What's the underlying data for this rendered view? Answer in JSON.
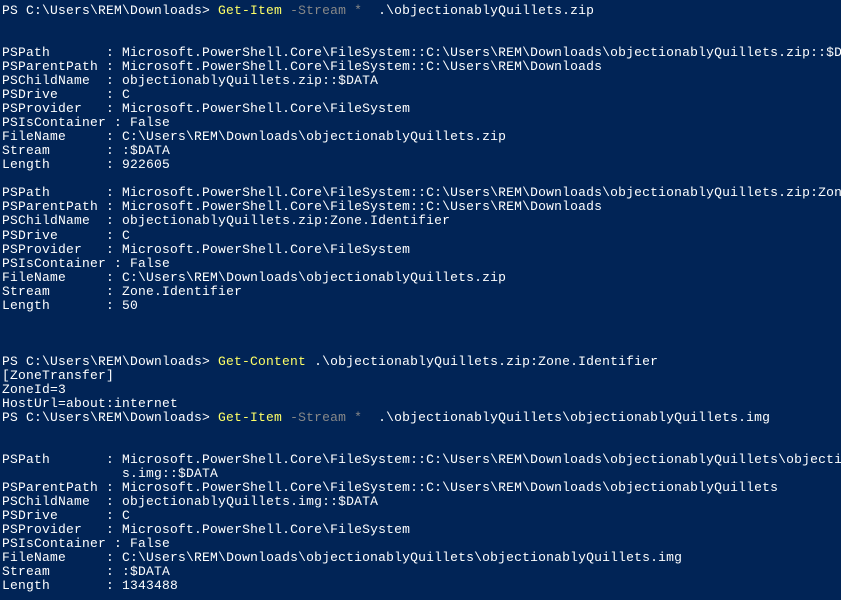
{
  "cmd1": {
    "prompt": "PS C:\\Users\\REM\\Downloads> ",
    "cmdlet": "Get-Item",
    "param": " -Stream *",
    "argument": "  .\\objectionablyQuillets.zip"
  },
  "out1": [
    {
      "label": "PSPath       ",
      "sep": ": ",
      "val": "Microsoft.PowerShell.Core\\FileSystem::C:\\Users\\REM\\Downloads\\objectionablyQuillets.zip::$DATA"
    },
    {
      "label": "PSParentPath ",
      "sep": ": ",
      "val": "Microsoft.PowerShell.Core\\FileSystem::C:\\Users\\REM\\Downloads"
    },
    {
      "label": "PSChildName  ",
      "sep": ": ",
      "val": "objectionablyQuillets.zip::$DATA"
    },
    {
      "label": "PSDrive      ",
      "sep": ": ",
      "val": "C"
    },
    {
      "label": "PSProvider   ",
      "sep": ": ",
      "val": "Microsoft.PowerShell.Core\\FileSystem"
    },
    {
      "label": "PSIsContainer",
      "sep": " : ",
      "val": "False"
    },
    {
      "label": "FileName     ",
      "sep": ": ",
      "val": "C:\\Users\\REM\\Downloads\\objectionablyQuillets.zip"
    },
    {
      "label": "Stream       ",
      "sep": ": ",
      "val": ":$DATA"
    },
    {
      "label": "Length       ",
      "sep": ": ",
      "val": "922605"
    }
  ],
  "out2": [
    {
      "label": "PSPath       ",
      "sep": ": ",
      "val": "Microsoft.PowerShell.Core\\FileSystem::C:\\Users\\REM\\Downloads\\objectionablyQuillets.zip:Zone.Identifier"
    },
    {
      "label": "PSParentPath ",
      "sep": ": ",
      "val": "Microsoft.PowerShell.Core\\FileSystem::C:\\Users\\REM\\Downloads"
    },
    {
      "label": "PSChildName  ",
      "sep": ": ",
      "val": "objectionablyQuillets.zip:Zone.Identifier"
    },
    {
      "label": "PSDrive      ",
      "sep": ": ",
      "val": "C"
    },
    {
      "label": "PSProvider   ",
      "sep": ": ",
      "val": "Microsoft.PowerShell.Core\\FileSystem"
    },
    {
      "label": "PSIsContainer",
      "sep": " : ",
      "val": "False"
    },
    {
      "label": "FileName     ",
      "sep": ": ",
      "val": "C:\\Users\\REM\\Downloads\\objectionablyQuillets.zip"
    },
    {
      "label": "Stream       ",
      "sep": ": ",
      "val": "Zone.Identifier"
    },
    {
      "label": "Length       ",
      "sep": ": ",
      "val": "50"
    }
  ],
  "cmd2": {
    "prompt": "PS C:\\Users\\REM\\Downloads> ",
    "cmdlet": "Get-Content",
    "argument": " .\\objectionablyQuillets.zip:Zone.Identifier"
  },
  "content_out": {
    "l1": "[ZoneTransfer]",
    "l2": "ZoneId=3",
    "l3": "HostUrl=about:internet"
  },
  "cmd3": {
    "prompt": "PS C:\\Users\\REM\\Downloads> ",
    "cmdlet": "Get-Item",
    "param": " -Stream *",
    "argument": "  .\\objectionablyQuillets\\objectionablyQuillets.img"
  },
  "out3": [
    {
      "label": "PSPath       ",
      "sep": ": ",
      "val": "Microsoft.PowerShell.Core\\FileSystem::C:\\Users\\REM\\Downloads\\objectionablyQuillets\\objectionablyQuillet"
    },
    {
      "label": "             ",
      "sep": "  ",
      "val": "s.img::$DATA"
    },
    {
      "label": "PSParentPath ",
      "sep": ": ",
      "val": "Microsoft.PowerShell.Core\\FileSystem::C:\\Users\\REM\\Downloads\\objectionablyQuillets"
    },
    {
      "label": "PSChildName  ",
      "sep": ": ",
      "val": "objectionablyQuillets.img::$DATA"
    },
    {
      "label": "PSDrive      ",
      "sep": ": ",
      "val": "C"
    },
    {
      "label": "PSProvider   ",
      "sep": ": ",
      "val": "Microsoft.PowerShell.Core\\FileSystem"
    },
    {
      "label": "PSIsContainer",
      "sep": " : ",
      "val": "False"
    },
    {
      "label": "FileName     ",
      "sep": ": ",
      "val": "C:\\Users\\REM\\Downloads\\objectionablyQuillets\\objectionablyQuillets.img"
    },
    {
      "label": "Stream       ",
      "sep": ": ",
      "val": ":$DATA"
    },
    {
      "label": "Length       ",
      "sep": ": ",
      "val": "1343488"
    }
  ]
}
